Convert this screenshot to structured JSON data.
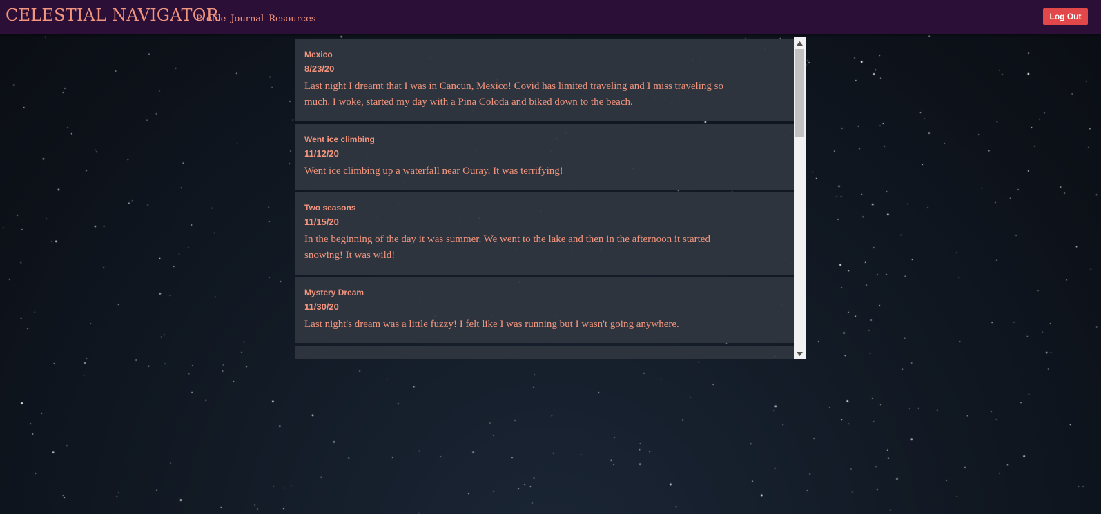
{
  "navbar": {
    "brand": "CELESTIAL NAVIGATOR",
    "links": [
      "Profile",
      "Journal",
      "Resources"
    ],
    "logout_label": "Log Out"
  },
  "journal": {
    "entries": [
      {
        "title": "Mexico",
        "date": "8/23/20",
        "text": "Last night I dreamt that I was in Cancun, Mexico! Covid has limited traveling and I miss traveling so much. I woke, started my day with a Pina Coloda and biked down to the beach."
      },
      {
        "title": "Went ice climbing",
        "date": "11/12/20",
        "text": "Went ice climbing up a waterfall near Ouray. It was terrifying!"
      },
      {
        "title": "Two seasons",
        "date": "11/15/20",
        "text": "In the beginning of the day it was summer. We went to the lake and then in the afternoon it started snowing! It was wild!"
      },
      {
        "title": "Mystery Dream",
        "date": "11/30/20",
        "text": "Last night's dream was a little fuzzy! I felt like I was running but I wasn't going anywhere."
      }
    ]
  },
  "colors": {
    "accent": "#f2957e",
    "navbar": "#2b0f36",
    "logout": "#e2484a",
    "card": "#303640"
  },
  "icons": {
    "scroll_up": "triangle-up-icon",
    "scroll_down": "triangle-down-icon"
  }
}
